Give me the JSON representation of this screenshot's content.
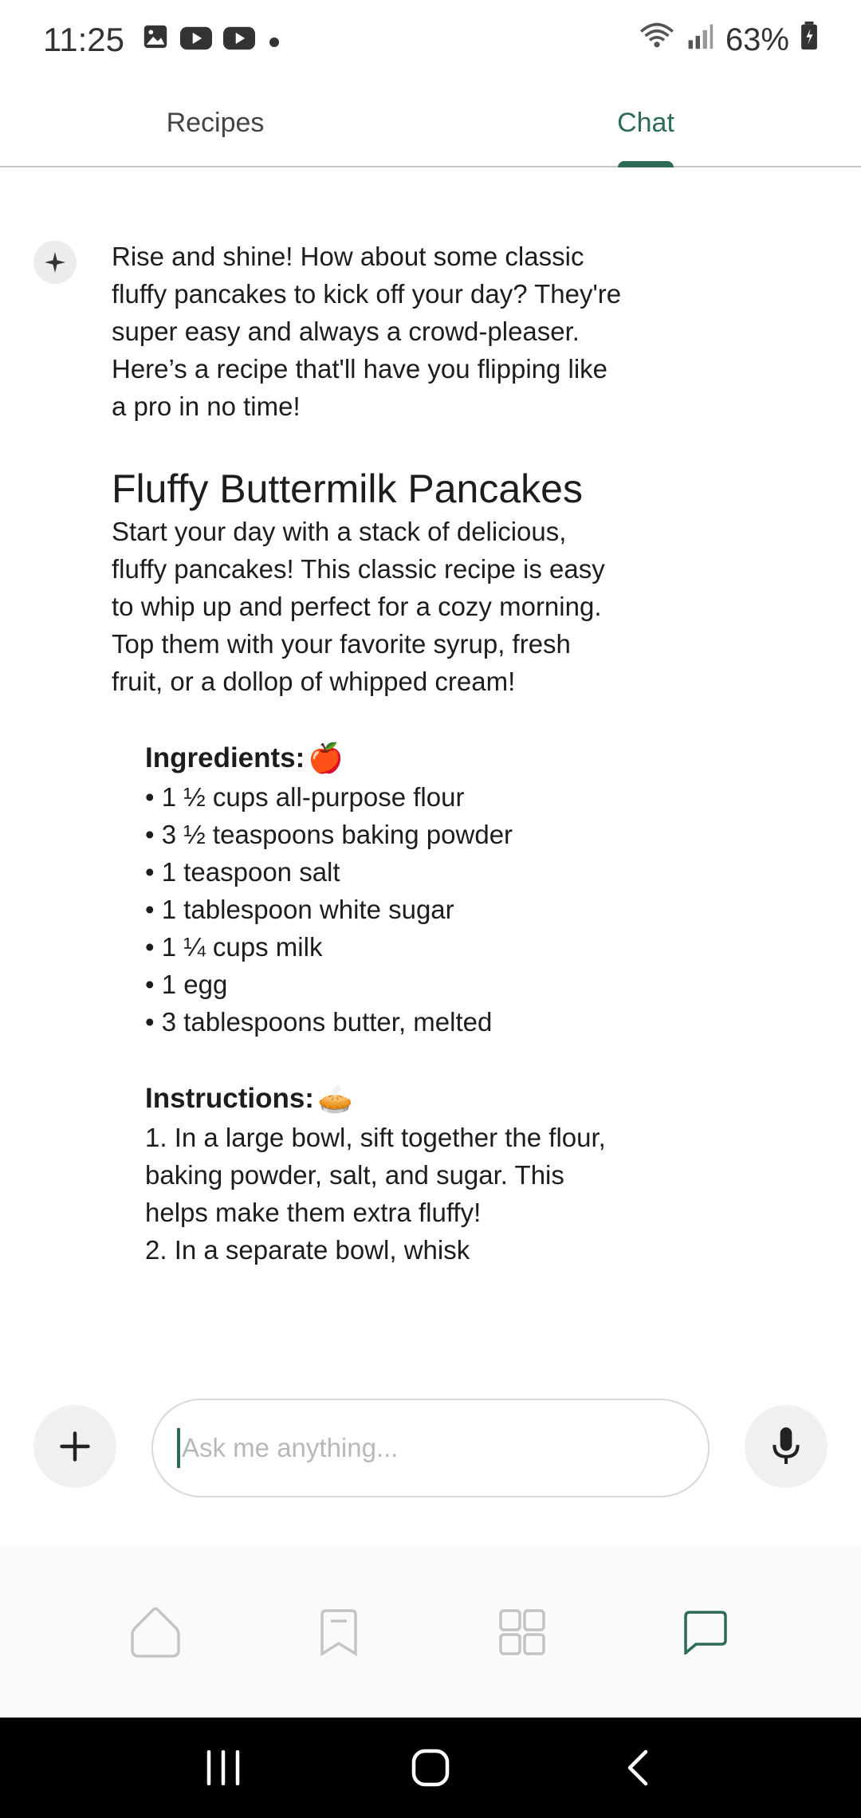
{
  "status_bar": {
    "time": "11:25",
    "battery": "63%",
    "notification_icons": [
      "image-icon",
      "youtube-icon",
      "youtube-icon",
      "dot-icon"
    ]
  },
  "tabs": [
    {
      "label": "Recipes",
      "active": false
    },
    {
      "label": "Chat",
      "active": true
    }
  ],
  "chat": {
    "intro": "Rise and shine! How about some classic fluffy pancakes to kick off your day? They're super easy and always a crowd-pleaser. Here’s a recipe that'll have you flipping like a pro in no time!",
    "recipe_title": "Fluffy Buttermilk Pancakes",
    "recipe_description": "Start your day with a stack of delicious, fluffy pancakes! This classic recipe is easy to whip up and perfect for a cozy morning. Top them with your favorite syrup, fresh fruit, or a dollop of whipped cream!",
    "ingredients_title": "Ingredients:",
    "ingredients_emoji": "🍎",
    "ingredients": [
      "• 1 ½ cups all-purpose flour",
      "• 3 ½ teaspoons baking powder",
      "• 1 teaspoon salt",
      "• 1 tablespoon white sugar",
      "• 1 ¼ cups milk",
      "• 1 egg",
      "• 3 tablespoons butter, melted"
    ],
    "instructions_title": "Instructions:",
    "instructions_emoji": "🥧",
    "instructions_text": "1. In a large bowl, sift together the flour, baking powder, salt, and sugar. This helps make them extra fluffy!",
    "instructions_text_2": "2. In a separate bowl, whisk"
  },
  "input": {
    "placeholder": "Ask me anything..."
  },
  "colors": {
    "accent": "#2e6b57",
    "inactive_icon": "#c4c4c4"
  }
}
